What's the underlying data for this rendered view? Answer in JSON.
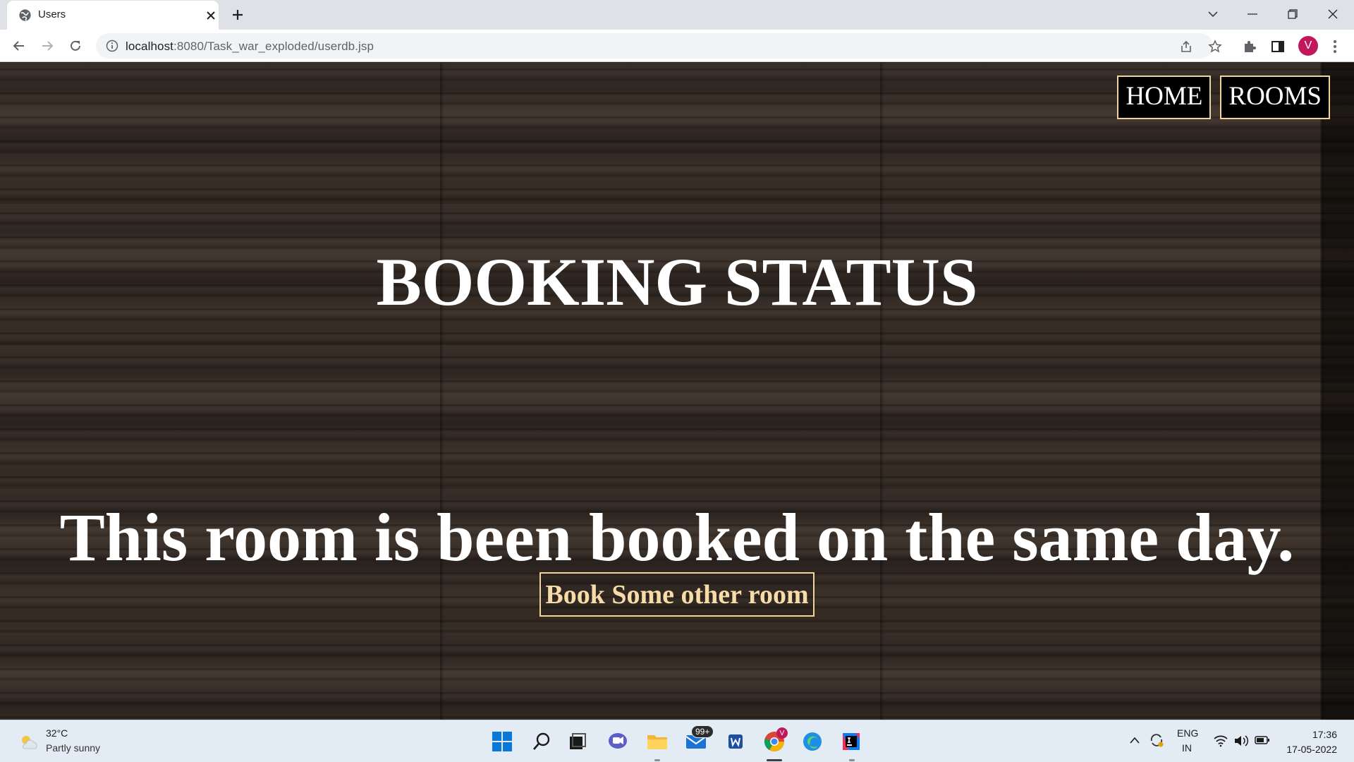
{
  "browser": {
    "tab_title": "Users",
    "url_host": "localhost",
    "url_path": ":8080/Task_war_exploded/userdb.jsp",
    "profile_initial": "V"
  },
  "page": {
    "nav": [
      {
        "label": "HOME"
      },
      {
        "label": "ROOMS"
      }
    ],
    "heading": "BOOKING STATUS",
    "message": "This room is been booked on the same day.",
    "button_label": "Book Some other room",
    "colors": {
      "accent_border": "#f2d39c",
      "button_text": "#f7dcaa",
      "heading_text": "#ffffff"
    }
  },
  "taskbar": {
    "weather_temp": "32°C",
    "weather_desc": "Partly sunny",
    "mail_badge": "99+",
    "lang_top": "ENG",
    "lang_bottom": "IN",
    "time": "17:36",
    "date": "17-05-2022",
    "chrome_badge": "V"
  }
}
